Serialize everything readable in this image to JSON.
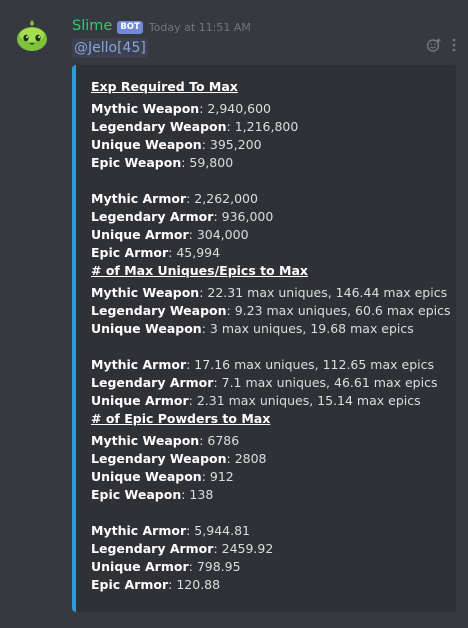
{
  "message": {
    "username": "Slime",
    "bot_tag": "BOT",
    "timestamp": "Today at 11:51 AM",
    "mention": "@Jello[45]",
    "username_color": "#2ecc71",
    "embed_accent": "#3498db",
    "icons": [
      "slime-avatar-icon",
      "add-reaction-icon",
      "more-options-icon"
    ]
  },
  "embed": {
    "exp": {
      "title": "Exp Required To Max",
      "weapons": [
        {
          "label": "Mythic Weapon",
          "value": ": 2,940,600"
        },
        {
          "label": "Legendary Weapon",
          "value": ": 1,216,800"
        },
        {
          "label": "Unique Weapon",
          "value": ": 395,200"
        },
        {
          "label": "Epic Weapon",
          "value": ": 59,800"
        }
      ],
      "armors": [
        {
          "label": "Mythic Armor",
          "value": ": 2,262,000"
        },
        {
          "label": "Legendary Armor",
          "value": ": 936,000"
        },
        {
          "label": "Unique Armor",
          "value": ": 304,000"
        },
        {
          "label": "Epic Armor",
          "value": ": 45,994"
        }
      ]
    },
    "max": {
      "title": "# of Max Uniques/Epics to Max",
      "weapons": [
        {
          "label": "Mythic Weapon",
          "value": ": 22.31 max uniques, 146.44 max epics"
        },
        {
          "label": "Legendary Weapon",
          "value": ": 9.23 max uniques, 60.6 max epics"
        },
        {
          "label": "Unique Weapon",
          "value": ": 3 max uniques, 19.68 max epics"
        }
      ],
      "armors": [
        {
          "label": "Mythic Armor",
          "value": ": 17.16 max uniques, 112.65 max epics"
        },
        {
          "label": "Legendary Armor",
          "value": ": 7.1 max uniques, 46.61 max epics"
        },
        {
          "label": "Unique Armor",
          "value": ": 2.31 max uniques, 15.14 max epics"
        }
      ]
    },
    "powders": {
      "title": "# of Epic Powders to Max",
      "weapons": [
        {
          "label": "Mythic Weapon",
          "value": ": 6786"
        },
        {
          "label": "Legendary Weapon",
          "value": ": 2808"
        },
        {
          "label": "Unique Weapon",
          "value": ": 912"
        },
        {
          "label": "Epic Weapon",
          "value": ": 138"
        }
      ],
      "armors": [
        {
          "label": "Mythic Armor",
          "value": ": 5,944.81"
        },
        {
          "label": "Legendary Armor",
          "value": ": 2459.92"
        },
        {
          "label": "Unique Armor",
          "value": ": 798.95"
        },
        {
          "label": "Epic Armor",
          "value": ": 120.88"
        }
      ]
    }
  }
}
